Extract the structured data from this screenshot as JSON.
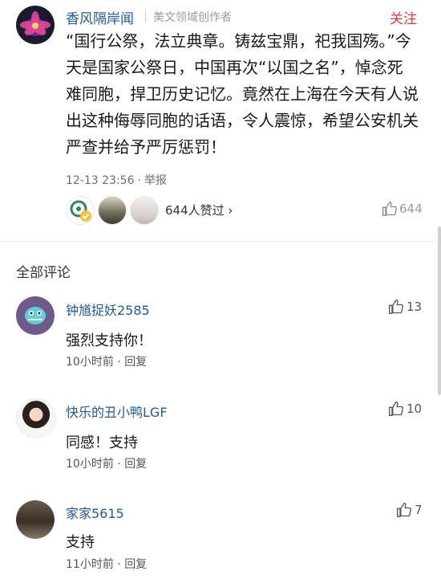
{
  "post": {
    "author": "香风隔岸闻",
    "badge": "美文领域创作者",
    "follow_label": "关注",
    "body": "“国行公祭，法立典章。铸兹宝鼎，祀我国殇。”今天是国家公祭日，中国再次“以国之名”，悼念死难同胞，捍卫历史记忆。竟然在上海在今天有人说出这种侮辱同胞的话语，令人震惊，希望公安机关严查并给予严厉惩罚！",
    "time": "12-13 23:56",
    "meta_sep": "·",
    "report_label": "举报",
    "likers_text": "644人赞过",
    "likers_chevron": "›",
    "like_count": "644"
  },
  "comments_section": {
    "title": "全部评论"
  },
  "comments": [
    {
      "name": "钟馗捉妖2585",
      "text": "强烈支持你！",
      "time": "10小时前",
      "sep": "·",
      "reply": "回复",
      "likes": "13"
    },
    {
      "name": "快乐的丑小鸭LGF",
      "text": "同感！支持",
      "time": "10小时前",
      "sep": "·",
      "reply": "回复",
      "likes": "10"
    },
    {
      "name": "家家5615",
      "text": "支持",
      "time": "11小时前",
      "sep": "·",
      "reply": "回复",
      "likes": "7"
    }
  ],
  "colors": {
    "link_blue": "#1f5aa6",
    "follow_red": "#e63b3b",
    "meta_gray": "#9a9a9a"
  },
  "icons": [
    "thumbs-up-icon",
    "chevron-right-icon",
    "verified-badge-icon"
  ]
}
